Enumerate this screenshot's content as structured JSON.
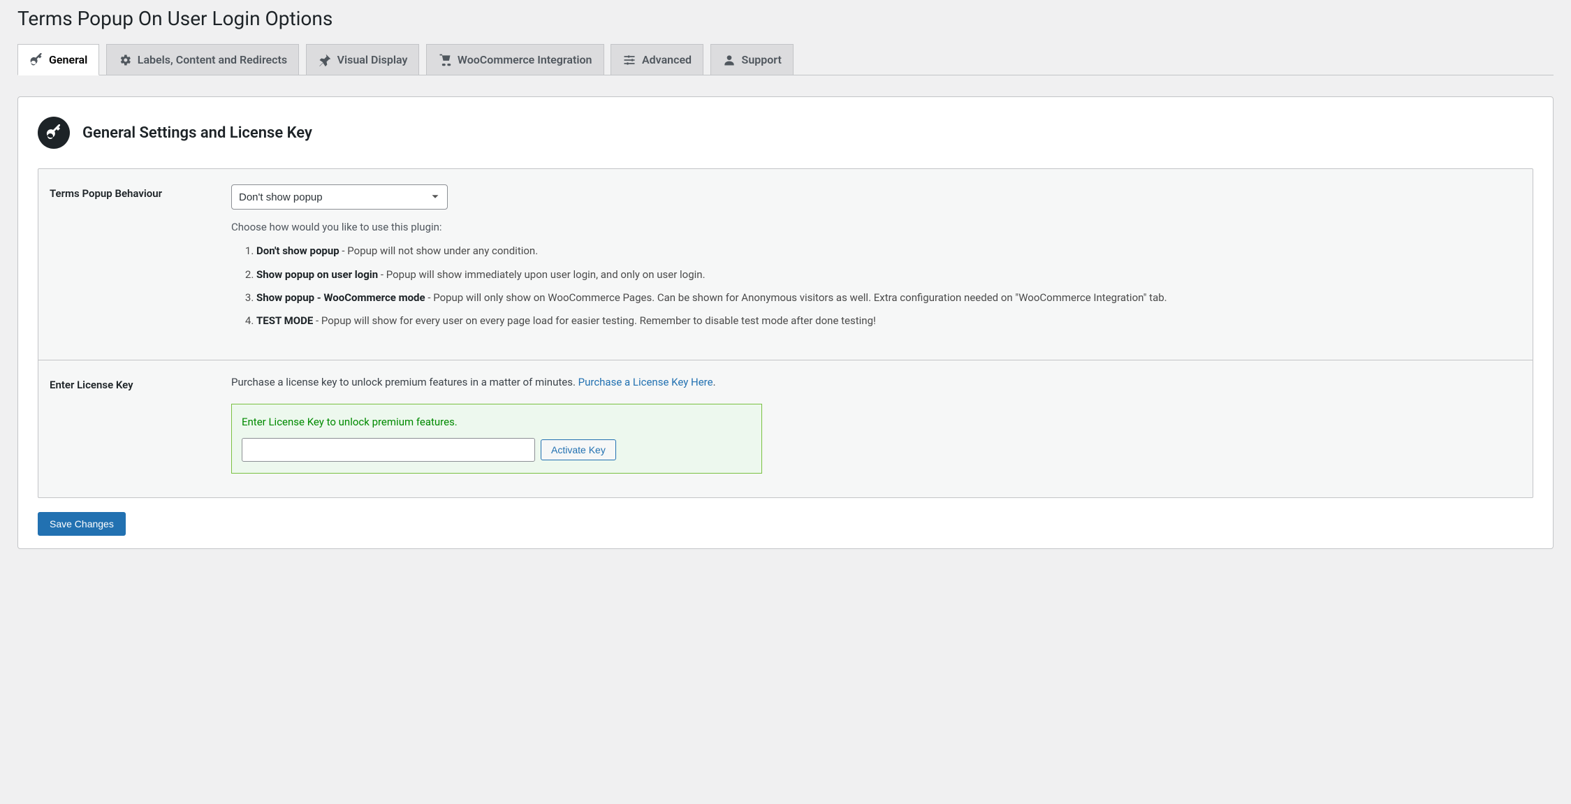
{
  "page_title": "Terms Popup On User Login Options",
  "tabs": [
    {
      "label": "General",
      "icon": "key-icon"
    },
    {
      "label": "Labels, Content and Redirects",
      "icon": "gear-icon"
    },
    {
      "label": "Visual Display",
      "icon": "pin-icon"
    },
    {
      "label": "WooCommerce Integration",
      "icon": "cart-icon"
    },
    {
      "label": "Advanced",
      "icon": "sliders-icon"
    },
    {
      "label": "Support",
      "icon": "user-icon"
    }
  ],
  "section": {
    "title": "General Settings and License Key"
  },
  "behaviour": {
    "label": "Terms Popup Behaviour",
    "selected": "Don't show popup",
    "help_intro": "Choose how would you like to use this plugin:",
    "options": [
      {
        "bold": "Don't show popup",
        "rest": " - Popup will not show under any condition."
      },
      {
        "bold": "Show popup on user login",
        "rest": " - Popup will show immediately upon user login, and only on user login."
      },
      {
        "bold": "Show popup - WooCommerce mode",
        "rest": " - Popup will only show on WooCommerce Pages. Can be shown for Anonymous visitors as well. Extra configuration needed on \"WooCommerce Integration\" tab."
      },
      {
        "bold": "TEST MODE",
        "rest": " - Popup will show for every user on every page load for easier testing. Remember to disable test mode after done testing!"
      }
    ]
  },
  "license": {
    "label": "Enter License Key",
    "purchase_text": "Purchase a license key to unlock premium features in a matter of minutes. ",
    "purchase_link": "Purchase a License Key Here",
    "purchase_suffix": ".",
    "hint": "Enter License Key to unlock premium features.",
    "input_value": "",
    "activate_button": "Activate Key"
  },
  "save_button": "Save Changes"
}
